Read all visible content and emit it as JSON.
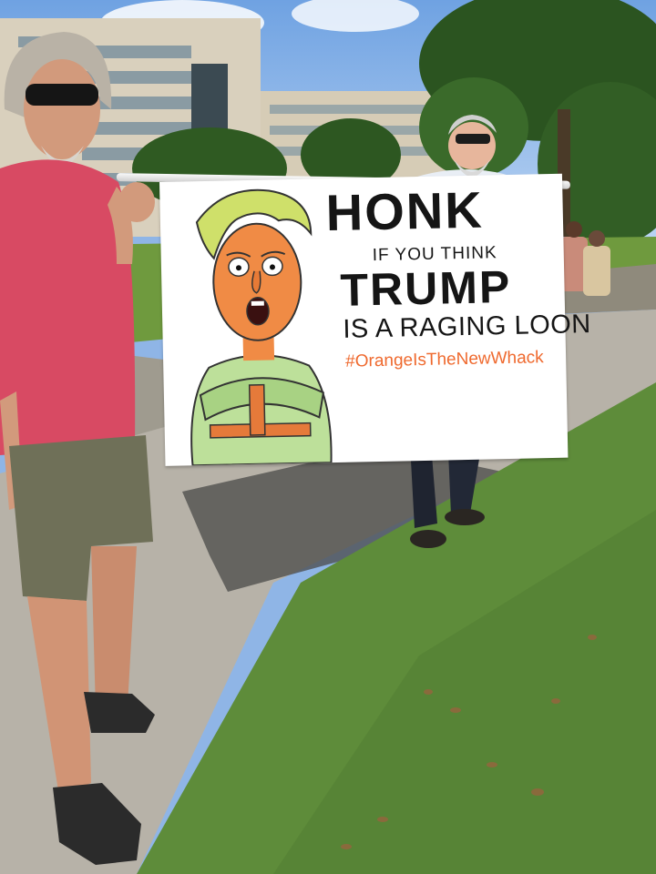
{
  "sign": {
    "line1": "HONK",
    "line2": "IF YOU THINK",
    "line3": "TRUMP",
    "line4": "IS A RAGING LOON",
    "hashtag": "#OrangeIsTheNewWhack"
  },
  "colors": {
    "sky": "#8fb5e6",
    "grass": "#5f8f3a",
    "sidewalk": "#b9b4aa",
    "shirt": "#d84a63",
    "hashtag": "#ef6a2f",
    "cartoon_skin": "#f08b45",
    "cartoon_hair": "#cfe06a",
    "straitjacket": "#bde09a"
  },
  "scene": {
    "people": [
      "left-protester",
      "right-protester"
    ],
    "objects": [
      "protest-banner",
      "building",
      "trees",
      "grass-verge",
      "sidewalk"
    ]
  }
}
